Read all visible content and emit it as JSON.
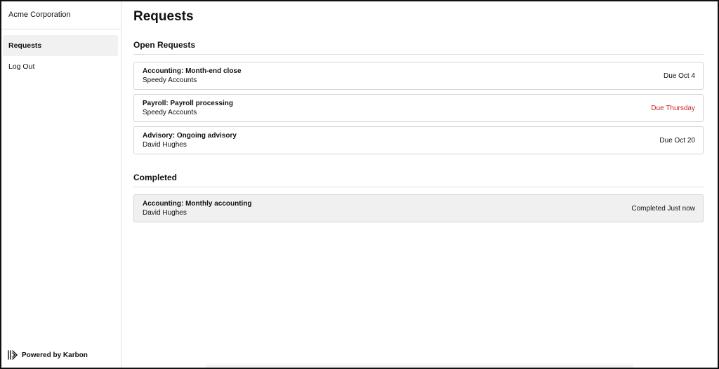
{
  "sidebar": {
    "org_name": "Acme Corporation",
    "items": [
      {
        "label": "Requests",
        "active": true
      },
      {
        "label": "Log Out",
        "active": false
      }
    ],
    "powered_by": "Powered by Karbon"
  },
  "main": {
    "title": "Requests",
    "open_section": "Open Requests",
    "completed_section": "Completed",
    "open_requests": [
      {
        "title": "Accounting: Month-end close",
        "client": "Speedy Accounts",
        "status": "Due Oct 4",
        "status_color": "#111111"
      },
      {
        "title": "Payroll: Payroll processing",
        "client": "Speedy Accounts",
        "status": "Due Thursday",
        "status_color": "#c62828"
      },
      {
        "title": "Advisory: Ongoing advisory",
        "client": "David Hughes",
        "status": "Due Oct 20",
        "status_color": "#111111"
      }
    ],
    "completed_requests": [
      {
        "title": "Accounting: Monthly accounting",
        "client": "David Hughes",
        "status": "Completed Just now"
      }
    ]
  },
  "icons": {
    "brand": "karbon-logo-icon"
  }
}
